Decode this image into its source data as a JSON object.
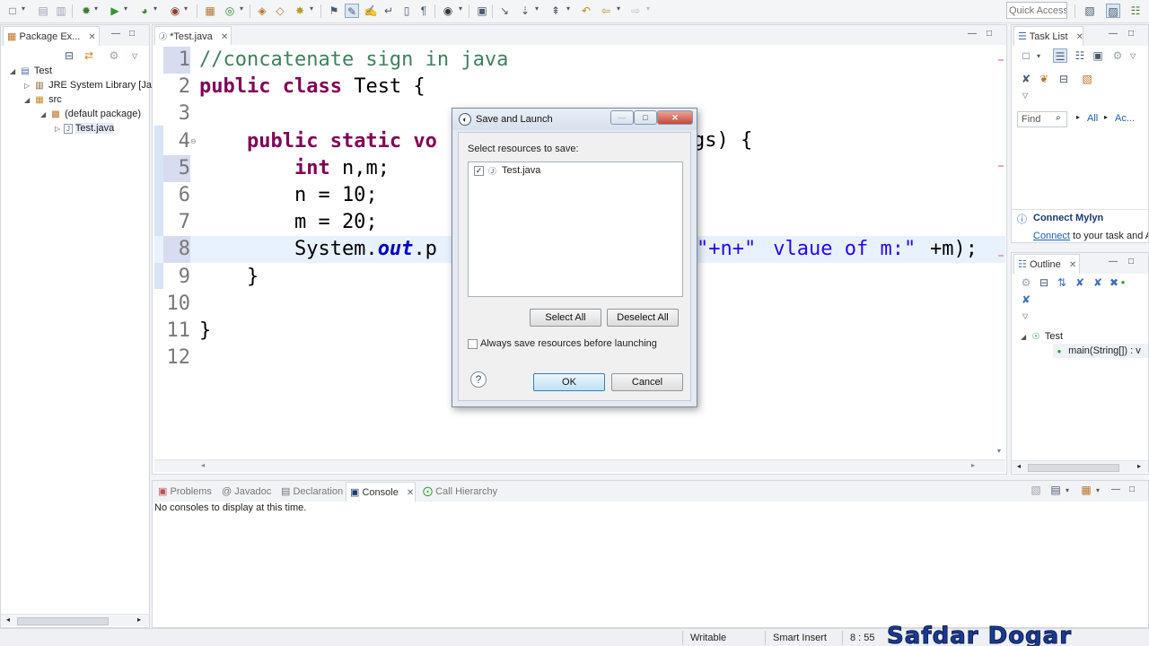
{
  "toolbar": {
    "quick_access_placeholder": "Quick Access",
    "icons": [
      "new-icon",
      "save-icon",
      "save-all-icon",
      "debug-icon",
      "run-icon",
      "coverage-icon",
      "external-tools-icon",
      "new-package-icon",
      "new-class-icon",
      "open-type-icon",
      "open-task-icon",
      "search-icon",
      "annotation-icon",
      "toggle-mark-occurrences-icon",
      "block-selection-icon",
      "word-wrap-icon",
      "show-whitespace-icon",
      "breadcrumb-icon",
      "pin-editor-icon",
      "next-annotation-icon",
      "prev-annotation-icon",
      "last-edit-icon",
      "back-icon",
      "forward-icon"
    ]
  },
  "package_explorer": {
    "tab_label": "Package Ex...",
    "tree": [
      {
        "label": "Test",
        "icon": "project-icon"
      },
      {
        "label": "JRE System Library [Jav",
        "icon": "library-icon"
      },
      {
        "label": "src",
        "icon": "source-folder-icon"
      },
      {
        "label": "(default package)",
        "icon": "package-icon"
      },
      {
        "label": "Test.java",
        "icon": "java-file-icon"
      }
    ]
  },
  "editor": {
    "tab_label": "*Test.java",
    "lines": [
      {
        "num": "1",
        "tokens": [
          {
            "t": "//concatenate sign in java",
            "c": "cmt"
          }
        ]
      },
      {
        "num": "2",
        "tokens": [
          {
            "t": "public class",
            "c": "kw"
          },
          {
            "t": " Test {",
            "c": ""
          }
        ]
      },
      {
        "num": "3",
        "tokens": []
      },
      {
        "num": "4",
        "tokens": [
          {
            "t": "    ",
            "c": ""
          },
          {
            "t": "public static",
            "c": "kw"
          },
          {
            "t": " vo",
            "c": "kw"
          }
        ]
      },
      {
        "num": "5",
        "tokens": [
          {
            "t": "        ",
            "c": ""
          },
          {
            "t": "int",
            "c": "kw"
          },
          {
            "t": " n,m;",
            "c": ""
          }
        ]
      },
      {
        "num": "6",
        "tokens": [
          {
            "t": "        n = 10;",
            "c": ""
          }
        ]
      },
      {
        "num": "7",
        "tokens": [
          {
            "t": "        m = 20;",
            "c": ""
          }
        ]
      },
      {
        "num": "8",
        "tokens": [
          {
            "t": "        System.",
            "c": ""
          },
          {
            "t": "out",
            "c": "fld"
          },
          {
            "t": ".p",
            "c": ""
          }
        ]
      },
      {
        "num": "9",
        "tokens": [
          {
            "t": "    }",
            "c": ""
          }
        ]
      },
      {
        "num": "10",
        "tokens": []
      },
      {
        "num": "11",
        "tokens": [
          {
            "t": "}",
            "c": ""
          }
        ]
      },
      {
        "num": "12",
        "tokens": []
      }
    ],
    "line4_tail": "gs) {",
    "line8_tail_a": "\"+n+\"",
    "line8_tail_b": " vlaue of m:\"",
    "line8_tail_c": "+m);"
  },
  "task_list": {
    "tab_label": "Task List",
    "find_placeholder": "Find",
    "all_label": "All",
    "activate_label": "Ac..."
  },
  "mylyn": {
    "title": "Connect Mylyn",
    "link": "Connect",
    "text": " to your task and A"
  },
  "outline": {
    "tab_label": "Outline",
    "class_label": "Test",
    "method_label": "main(String[]) : v"
  },
  "bottom_panel": {
    "tabs": [
      "Problems",
      "Javadoc",
      "Declaration",
      "Console",
      "Call Hierarchy"
    ],
    "active_tab": "Console",
    "message": "No consoles to display at this time."
  },
  "dialog": {
    "title": "Save and Launch",
    "prompt": "Select resources to save:",
    "resource": "Test.java",
    "resource_checked": true,
    "select_all": "Select All",
    "deselect_all": "Deselect All",
    "always_save": "Always save resources before launching",
    "always_save_checked": false,
    "ok": "OK",
    "cancel": "Cancel"
  },
  "status_bar": {
    "writable": "Writable",
    "insert_mode": "Smart Insert",
    "position": "8 : 55"
  },
  "watermark": "Safdar Dogar"
}
